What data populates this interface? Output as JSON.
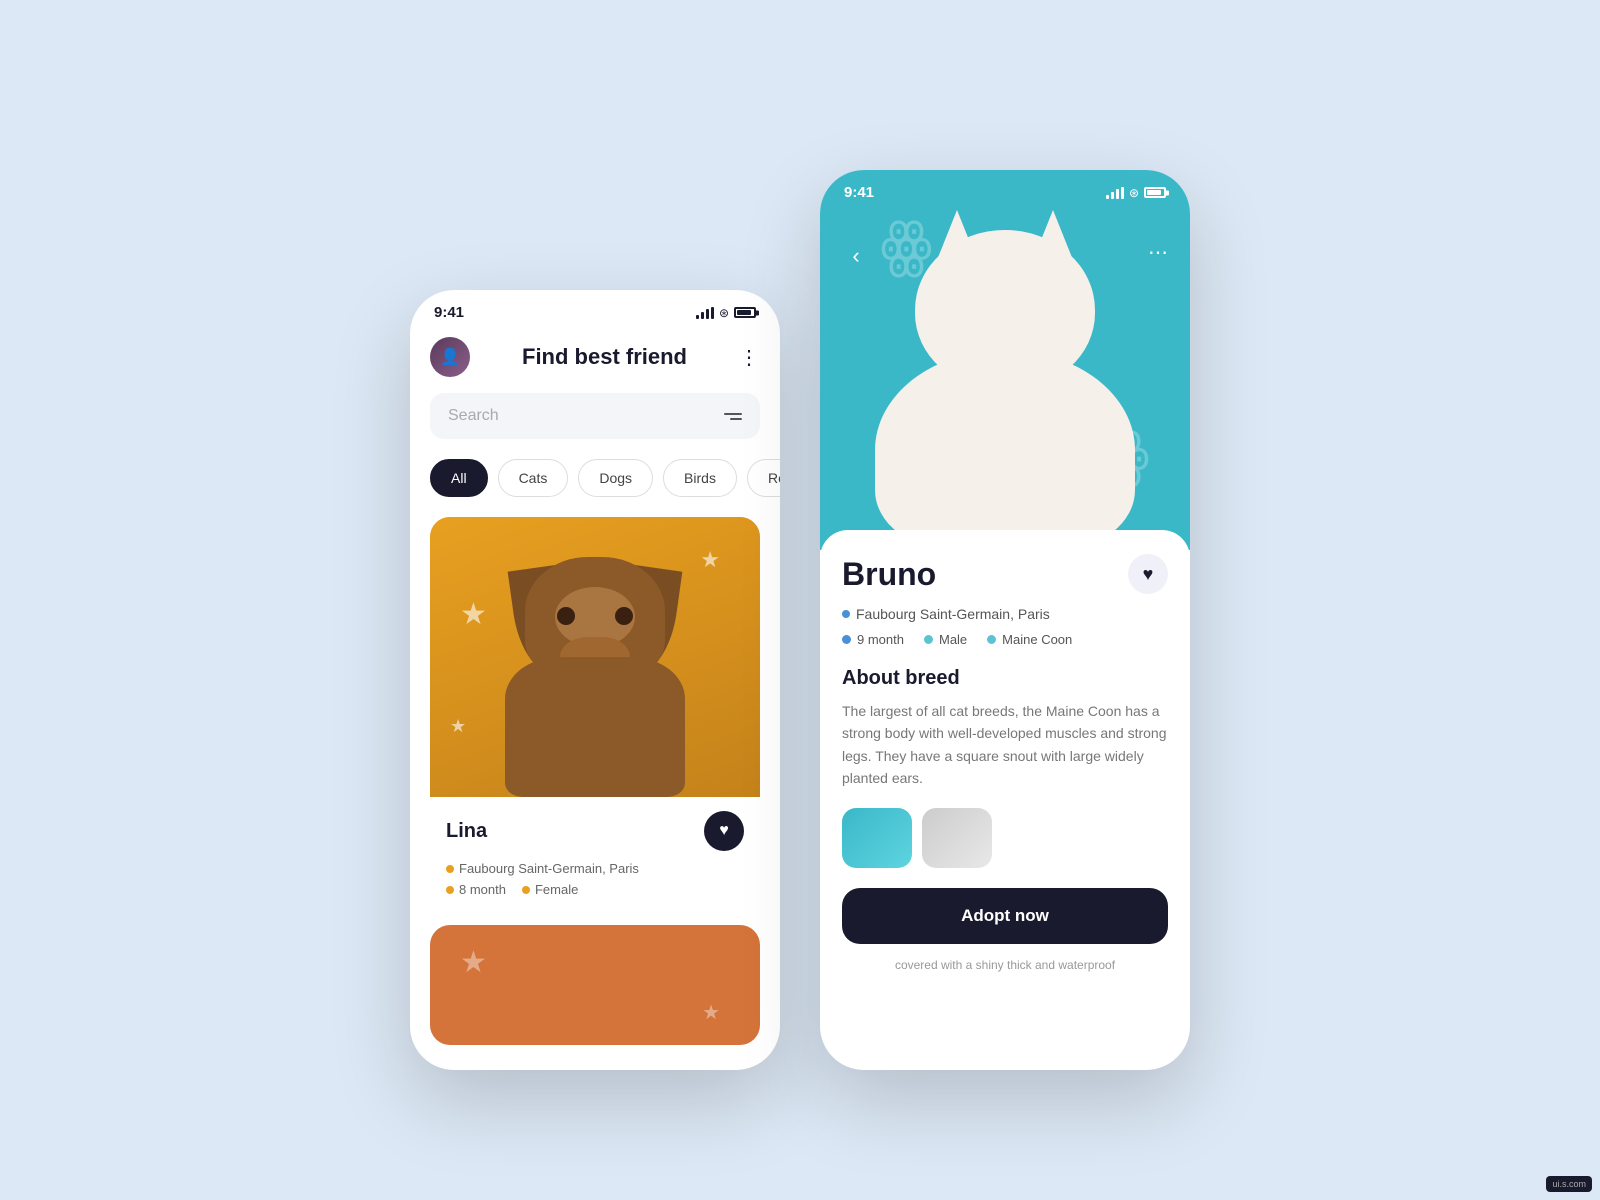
{
  "background_color": "#dce8f5",
  "phone1": {
    "status_bar": {
      "time": "9:41"
    },
    "header": {
      "title": "Find best friend",
      "menu_label": "⋮"
    },
    "search": {
      "placeholder": "Search"
    },
    "categories": [
      {
        "label": "All",
        "active": true
      },
      {
        "label": "Cats",
        "active": false
      },
      {
        "label": "Dogs",
        "active": false
      },
      {
        "label": "Birds",
        "active": false
      },
      {
        "label": "Ro...",
        "active": false
      }
    ],
    "pet_card": {
      "name": "Lina",
      "location": "Faubourg Saint-Germain, Paris",
      "age": "8 month",
      "gender": "Female"
    }
  },
  "phone2": {
    "status_bar": {
      "time": "9:41"
    },
    "nav": {
      "back_label": "‹",
      "more_label": "⋯"
    },
    "pet": {
      "name": "Bruno",
      "location": "Faubourg Saint-Germain, Paris",
      "age": "9 month",
      "gender": "Male",
      "breed": "Maine Coon"
    },
    "about": {
      "section_title": "About breed",
      "description": "The largest of all cat breeds, the Maine Coon has a strong body with well-developed muscles and strong legs. They have a square snout with large widely planted ears."
    },
    "adopt_button_label": "Adopt now",
    "bottom_text": "covered with a shiny thick and waterproof"
  },
  "watermark": "ui.s.com"
}
